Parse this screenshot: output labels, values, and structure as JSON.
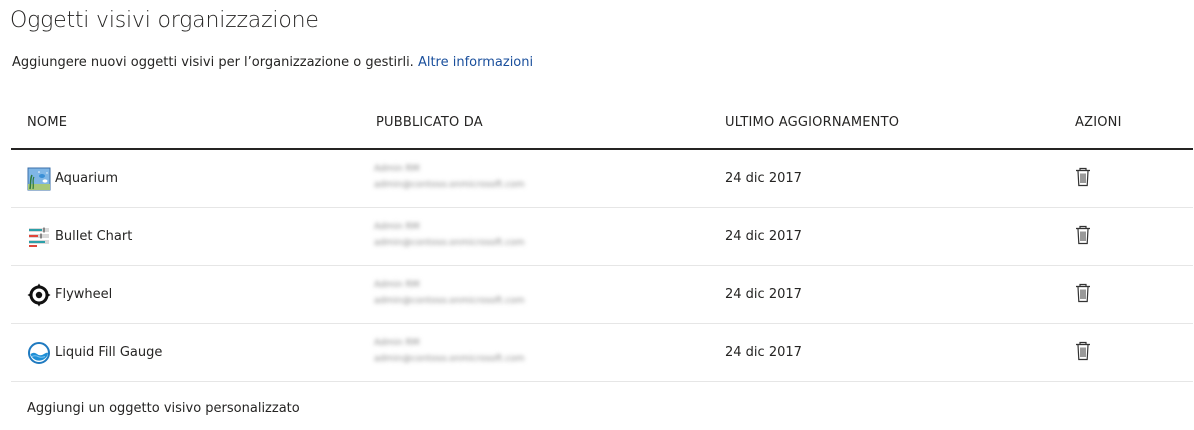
{
  "page": {
    "title": "Oggetti visivi organizzazione",
    "subtitle": "Aggiungere nuovi oggetti visivi per l’organizzazione o gestirli. ",
    "learn_more": "Altre informazioni"
  },
  "table": {
    "headers": {
      "name": "NOME",
      "published_by": "PUBBLICATO DA",
      "last_updated": "ULTIMO AGGIORNAMENTO",
      "actions": "AZIONI"
    },
    "rows": [
      {
        "name": "Aquarium",
        "icon": "aquarium-icon",
        "published_by_line1": "Admin RM",
        "published_by_line2": "admin@contoso.onmicrosoft.com",
        "date": "24 dic 2017",
        "action_icon": "trash-icon"
      },
      {
        "name": "Bullet Chart",
        "icon": "bullet-chart-icon",
        "published_by_line1": "Admin RM",
        "published_by_line2": "admin@contoso.onmicrosoft.com",
        "date": "24 dic 2017",
        "action_icon": "trash-icon"
      },
      {
        "name": "Flywheel",
        "icon": "flywheel-icon",
        "published_by_line1": "Admin RM",
        "published_by_line2": "admin@contoso.onmicrosoft.com",
        "date": "24 dic 2017",
        "action_icon": "trash-icon"
      },
      {
        "name": "Liquid Fill Gauge",
        "icon": "liquid-fill-gauge-icon",
        "published_by_line1": "Admin RM",
        "published_by_line2": "admin@contoso.onmicrosoft.com",
        "date": "24 dic 2017",
        "action_icon": "trash-icon"
      }
    ]
  },
  "add_visual": "Aggiungi un oggetto visivo personalizzato",
  "colors": {
    "text": "#252423",
    "link": "#1a4f9c",
    "row_divider": "#e6e6e6",
    "header_divider": "#252423"
  }
}
